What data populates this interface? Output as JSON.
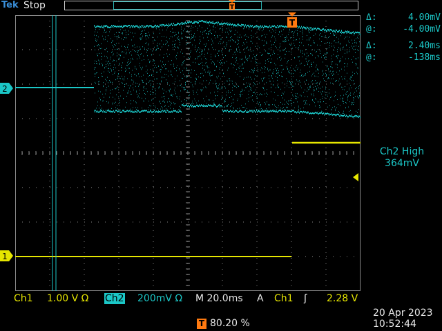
{
  "header": {
    "brand": "Tek",
    "run_state": "Stop"
  },
  "cursor_readouts": [
    {
      "symbol": "Δ:",
      "value": "4.00mV"
    },
    {
      "symbol": "@:",
      "value": "-4.00mV"
    },
    {
      "symbol": "Δ:",
      "value": "2.40ms"
    },
    {
      "symbol": "@:",
      "value": "-138ms"
    }
  ],
  "channel_level": {
    "label": "Ch2 High",
    "value": "364mV"
  },
  "markers": {
    "ch1": "1",
    "ch2": "2",
    "trigger": "T"
  },
  "bottom_bar": {
    "ch1_label": "Ch1",
    "ch1_scale": "1.00 V Ω",
    "ch2_label": "Ch2",
    "ch2_scale": "200mV Ω",
    "timebase": "M 20.0ms",
    "trigger_mode": "A",
    "trigger_source": "Ch1",
    "trigger_slope": "ʃ",
    "trigger_level": "2.28 V"
  },
  "trigger_position": "80.20 %",
  "date": "20 Apr  2023",
  "time": "10:52:44",
  "colors": {
    "ch1": "#e6e600",
    "ch2": "#1bc7c7",
    "trigger": "#ff7a10",
    "grid": "#8a8a8a"
  }
}
